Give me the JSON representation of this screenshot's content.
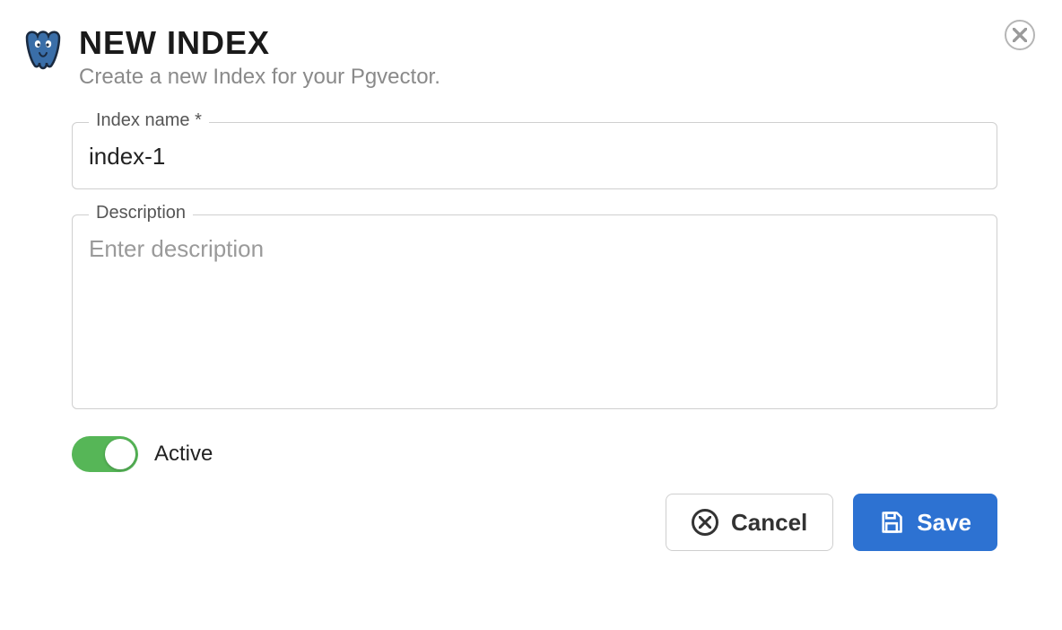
{
  "header": {
    "title": "NEW INDEX",
    "subtitle": "Create a new Index for your Pgvector."
  },
  "fields": {
    "indexName": {
      "label": "Index name *",
      "value": "index-1"
    },
    "description": {
      "label": "Description",
      "placeholder": "Enter description",
      "value": ""
    }
  },
  "toggle": {
    "label": "Active",
    "checked": true
  },
  "actions": {
    "cancel": "Cancel",
    "save": "Save"
  }
}
